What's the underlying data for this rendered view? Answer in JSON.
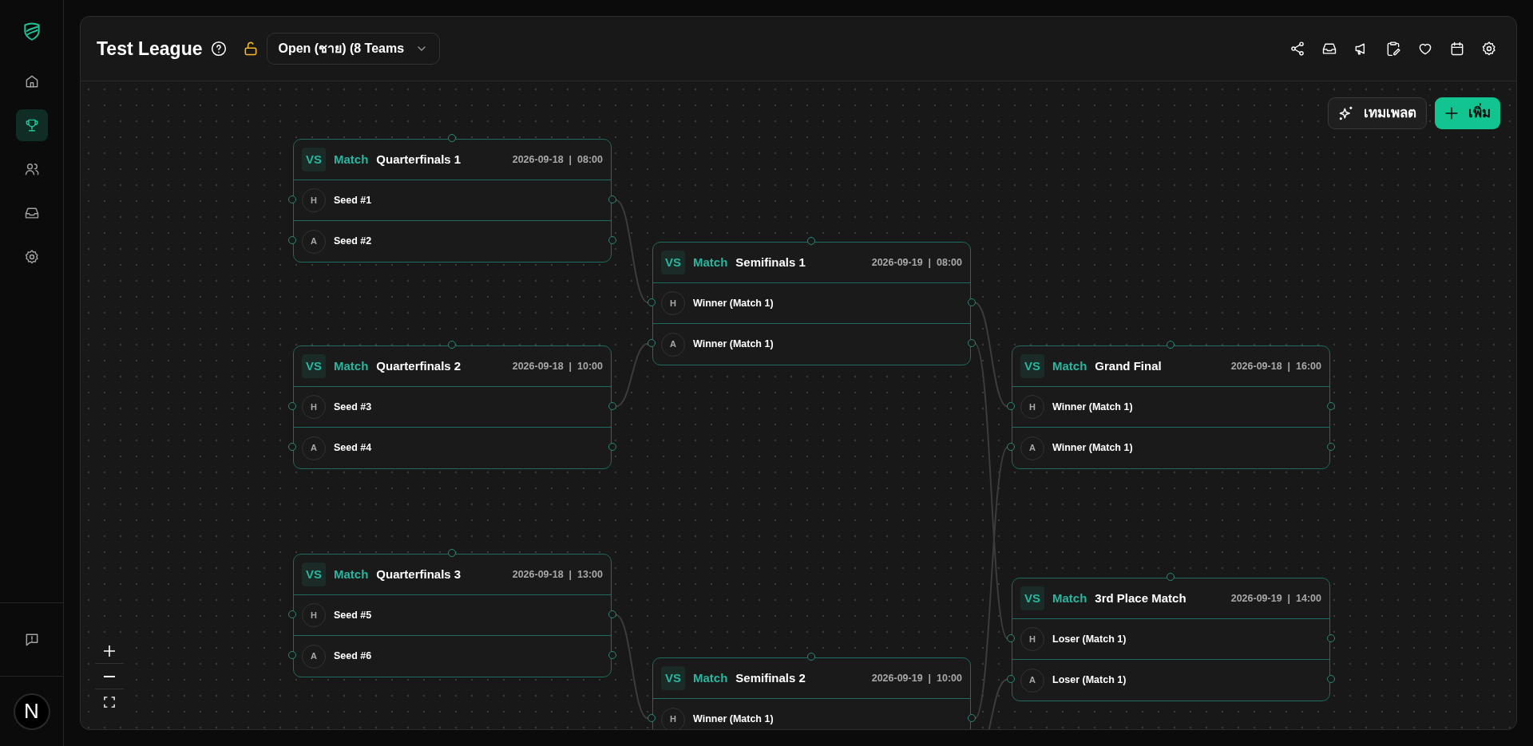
{
  "sidebar": {
    "nav": [
      {
        "kind": "home",
        "selected": false
      },
      {
        "kind": "trophy",
        "selected": true
      },
      {
        "kind": "users",
        "selected": false
      },
      {
        "kind": "inbox",
        "selected": false
      },
      {
        "kind": "settings",
        "selected": false
      }
    ],
    "avatar": "N"
  },
  "header": {
    "title": "Test League",
    "division": "Open (ชาย) (8 Teams"
  },
  "actions": {
    "template": "เทมเพลต",
    "add": "เพิ่ม"
  },
  "matches": [
    {
      "badge": "VS",
      "label": "Match",
      "title": "Quarterfinals 1",
      "schedule": "2026-09-18  |  08:00",
      "teams": [
        {
          "side": "H",
          "name": "Seed #1"
        },
        {
          "side": "A",
          "name": "Seed #2"
        }
      ]
    },
    {
      "badge": "VS",
      "label": "Match",
      "title": "Quarterfinals 2",
      "schedule": "2026-09-18  |  10:00",
      "teams": [
        {
          "side": "H",
          "name": "Seed #3"
        },
        {
          "side": "A",
          "name": "Seed #4"
        }
      ]
    },
    {
      "badge": "VS",
      "label": "Match",
      "title": "Quarterfinals 3",
      "schedule": "2026-09-18  |  13:00",
      "teams": [
        {
          "side": "H",
          "name": "Seed #5"
        },
        {
          "side": "A",
          "name": "Seed #6"
        }
      ]
    },
    {
      "badge": "VS",
      "label": "Match",
      "title": "Semifinals 1",
      "schedule": "2026-09-19  |  08:00",
      "teams": [
        {
          "side": "H",
          "name": "Winner (Match 1)"
        },
        {
          "side": "A",
          "name": "Winner (Match 1)"
        }
      ]
    },
    {
      "badge": "VS",
      "label": "Match",
      "title": "Semifinals 2",
      "schedule": "2026-09-19  |  10:00",
      "teams": [
        {
          "side": "H",
          "name": "Winner (Match 1)"
        }
      ]
    },
    {
      "badge": "VS",
      "label": "Match",
      "title": "Grand Final",
      "schedule": "2026-09-18  |  16:00",
      "teams": [
        {
          "side": "H",
          "name": "Winner (Match 1)"
        },
        {
          "side": "A",
          "name": "Winner (Match 1)"
        }
      ]
    },
    {
      "badge": "VS",
      "label": "Match",
      "title": "3rd Place Match",
      "schedule": "2026-09-19  |  14:00",
      "teams": [
        {
          "side": "H",
          "name": "Loser (Match 1)"
        },
        {
          "side": "A",
          "name": "Loser (Match 1)"
        }
      ]
    }
  ]
}
